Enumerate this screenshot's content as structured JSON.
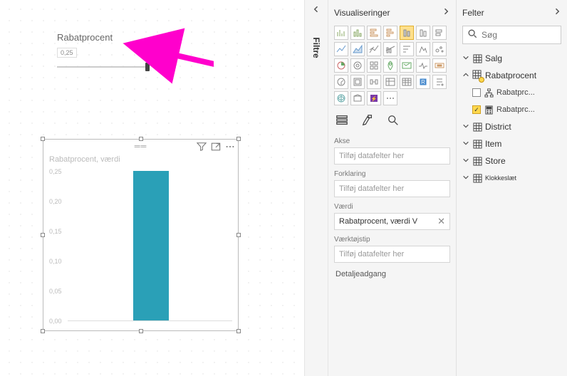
{
  "slicer": {
    "title": "Rabatprocent",
    "value": "0,25"
  },
  "chart": {
    "title": "Rabatprocent, værdi"
  },
  "chart_data": {
    "type": "bar",
    "categories": [
      ""
    ],
    "values": [
      0.25
    ],
    "title": "Rabatprocent, værdi",
    "xlabel": "",
    "ylabel": "",
    "ylim": [
      0,
      0.25
    ],
    "yticks": [
      0.0,
      0.05,
      0.1,
      0.15,
      0.2,
      0.25
    ]
  },
  "rail": {
    "label": "Filtre"
  },
  "viz": {
    "title": "Visualiseringer",
    "sections": {
      "axis": "Akse",
      "legend": "Forklaring",
      "value": "Værdi",
      "tooltip": "Værktøjstip",
      "drill": "Detaljeadgang"
    },
    "placeholder": "Tilføj datafelter her",
    "value_field": "Rabatprocent, værdi V"
  },
  "fields": {
    "title": "Felter",
    "search_placeholder": "Søg",
    "tables": {
      "salg": "Salg",
      "rabat": "Rabatprocent",
      "rabat_field1": "Rabatprc...",
      "rabat_field2": "Rabatprc...",
      "district": "District",
      "item": "Item",
      "store": "Store",
      "klokke": "Klokkeslæt"
    }
  }
}
